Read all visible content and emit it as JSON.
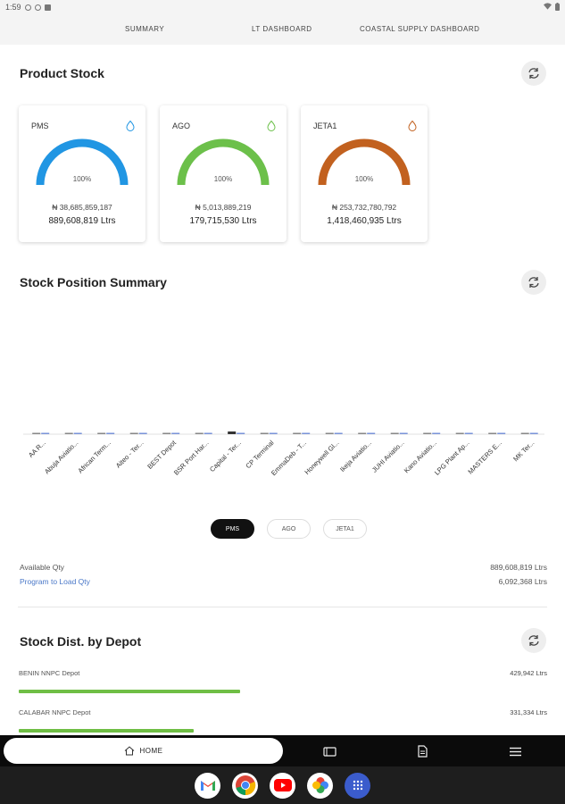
{
  "status_bar": {
    "time": "1:59"
  },
  "tabs": [
    {
      "label": "SUMMARY"
    },
    {
      "label": "LT DASHBOARD"
    },
    {
      "label": "COASTAL SUPPLY DASHBOARD"
    }
  ],
  "product_stock": {
    "title": "Product Stock",
    "cards": [
      {
        "name": "PMS",
        "percent": "100%",
        "value_naira": "₦ 38,685,859,187",
        "litres": "889,608,819 Ltrs",
        "color": "#2196e3",
        "fill_fraction": 1.0
      },
      {
        "name": "AGO",
        "percent": "100%",
        "value_naira": "₦ 5,013,889,219",
        "litres": "179,715,530 Ltrs",
        "color": "#6cc04a",
        "fill_fraction": 1.0
      },
      {
        "name": "JETA1",
        "percent": "100%",
        "value_naira": "₦ 253,732,780,792",
        "litres": "1,418,460,935 Ltrs",
        "color": "#c2611f",
        "fill_fraction": 1.0
      }
    ]
  },
  "stock_position": {
    "title": "Stock Position Summary",
    "filters": [
      {
        "label": "PMS",
        "active": true
      },
      {
        "label": "AGO",
        "active": false
      },
      {
        "label": "JETA1",
        "active": false
      }
    ],
    "available_label": "Available Qty",
    "available_value": "889,608,819 Ltrs",
    "program_label": "Program to Load Qty",
    "program_value": "6,092,368 Ltrs"
  },
  "chart_data": {
    "type": "bar",
    "categories": [
      "AA R...",
      "Abuja Aviatio...",
      "African Term...",
      "Aiteo - Ter...",
      "BEST Depot",
      "BSR Port Har...",
      "Capital - Ter...",
      "CP Terminal",
      "EmmaDeb - T...",
      "Honeywell Gl...",
      "Ikeja Aviatio...",
      "JUHI Aviatio...",
      "Kano Aviatio...",
      "LPG Plant Ap...",
      "MASTERS E...",
      "MK Ter..."
    ],
    "series": [
      {
        "color": "#888888",
        "values": [
          0.2,
          0.2,
          0.2,
          0.2,
          0.2,
          0.2,
          1,
          0.2,
          0.2,
          0.2,
          0.2,
          0.2,
          0.2,
          0.2,
          0.2,
          0.2
        ]
      },
      {
        "color": "#7a93d8",
        "values": [
          0.2,
          0.2,
          0.2,
          0.2,
          0.2,
          0.2,
          0.2,
          0.2,
          0.2,
          0.2,
          0.2,
          0.2,
          0.2,
          0.2,
          0.2,
          0.2
        ]
      }
    ],
    "grid": false
  },
  "stock_dist": {
    "title": "Stock Dist. by Depot",
    "depots": [
      {
        "name": "BENIN NNPC Depot",
        "value": "429,942 Ltrs",
        "bar_fraction": 1.0
      },
      {
        "name": "CALABAR NNPC Depot",
        "value": "331,334 Ltrs",
        "bar_fraction": 0.79
      }
    ]
  },
  "nav": {
    "home_label": "HOME"
  },
  "dock": [
    {
      "icon": "gmail-icon"
    },
    {
      "icon": "chrome-icon"
    },
    {
      "icon": "youtube-icon"
    },
    {
      "icon": "photos-icon"
    },
    {
      "icon": "app-drawer-icon"
    }
  ]
}
